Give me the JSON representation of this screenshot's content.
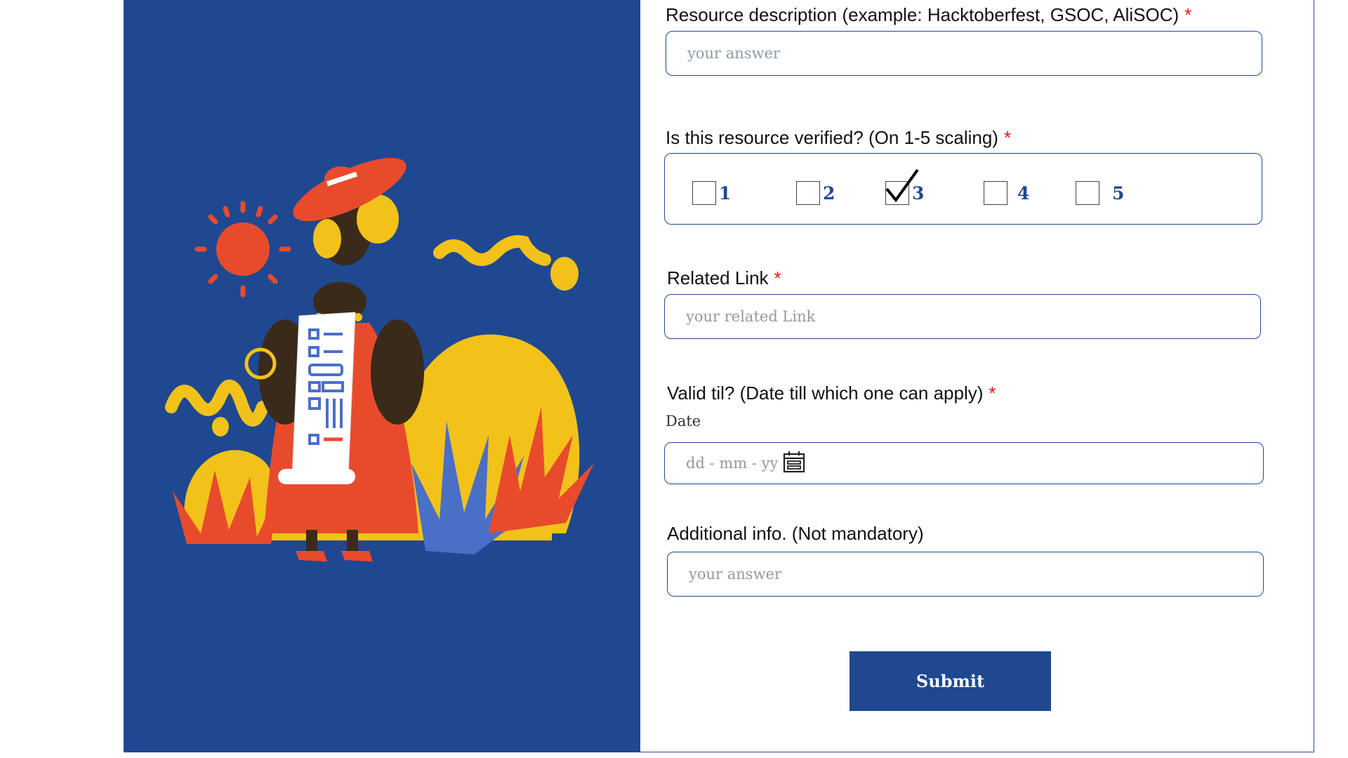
{
  "form": {
    "resource_description": {
      "label": "Resource description (example: Hacktoberfest, GSOC, AliSOC)",
      "required_mark": "*",
      "placeholder": "your answer"
    },
    "verified": {
      "label": "Is this resource verified? (On 1-5 scaling)",
      "required_mark": "*",
      "options": [
        "1",
        "2",
        "3",
        "4",
        "5"
      ],
      "selected": "3"
    },
    "related_link": {
      "label": "Related Link",
      "required_mark": "*",
      "placeholder": "your related Link"
    },
    "valid_til": {
      "label": "Valid til? (Date till which one can apply)",
      "required_mark": "*",
      "sub_label": "Date",
      "placeholder": "dd - mm - yy"
    },
    "additional_info": {
      "label": "Additional info. (Not mandatory)",
      "placeholder": "your answer"
    },
    "submit_label": "Submit"
  },
  "colors": {
    "panel_blue": "#1f4891",
    "accent_red": "#e84b2c",
    "accent_yellow": "#f2c21b",
    "skin": "#3a2a1a",
    "required_red": "#e01919"
  },
  "icons": {
    "calendar": "calendar-icon",
    "check": "check-mark-icon"
  }
}
